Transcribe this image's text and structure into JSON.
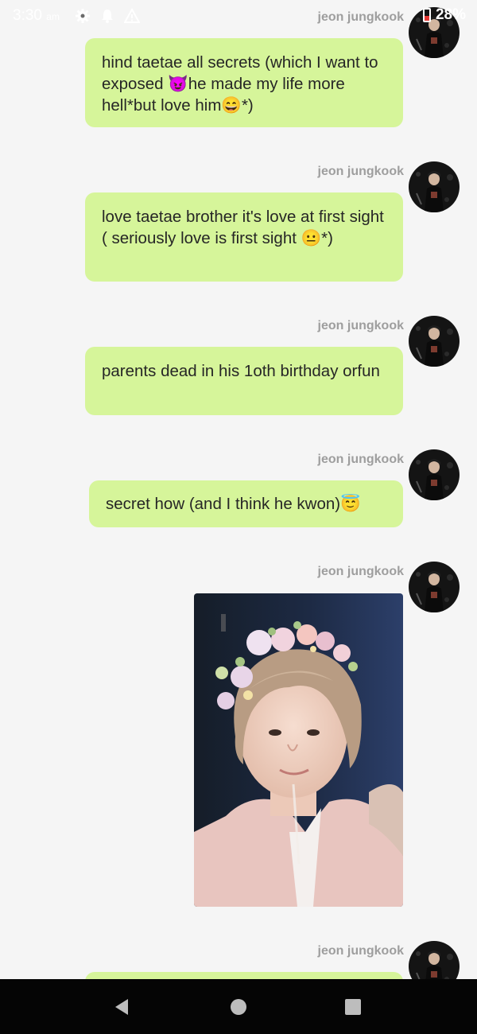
{
  "status_bar": {
    "time": "3:30",
    "time_suffix": "am",
    "battery": "28%",
    "icons": [
      "gear-icon",
      "bell-icon",
      "warning-icon",
      "battery-icon"
    ]
  },
  "messages": [
    {
      "sender": "jeon jungkook",
      "text": "hind taetae all secrets (which I want to exposed 😈he made my life more hell*but love him😄*)"
    },
    {
      "sender": "jeon jungkook",
      "text": "love taetae brother it's love at first sight  ( seriously love is first sight 😐*)"
    },
    {
      "sender": "jeon jungkook",
      "text": "parents dead in his 1oth birthday orfun"
    },
    {
      "sender": "jeon jungkook",
      "text": "secret how (and I think he kwon)😇"
    },
    {
      "sender": "jeon jungkook",
      "image": "photo of a person wearing a flower crown"
    },
    {
      "sender": "jeon jungkook",
      "text": ""
    }
  ],
  "nav": [
    "back-icon",
    "home-icon",
    "recents-icon"
  ],
  "colors": {
    "bubble": "#d6f59a",
    "background": "#f5f5f5",
    "nav": "#050505"
  }
}
